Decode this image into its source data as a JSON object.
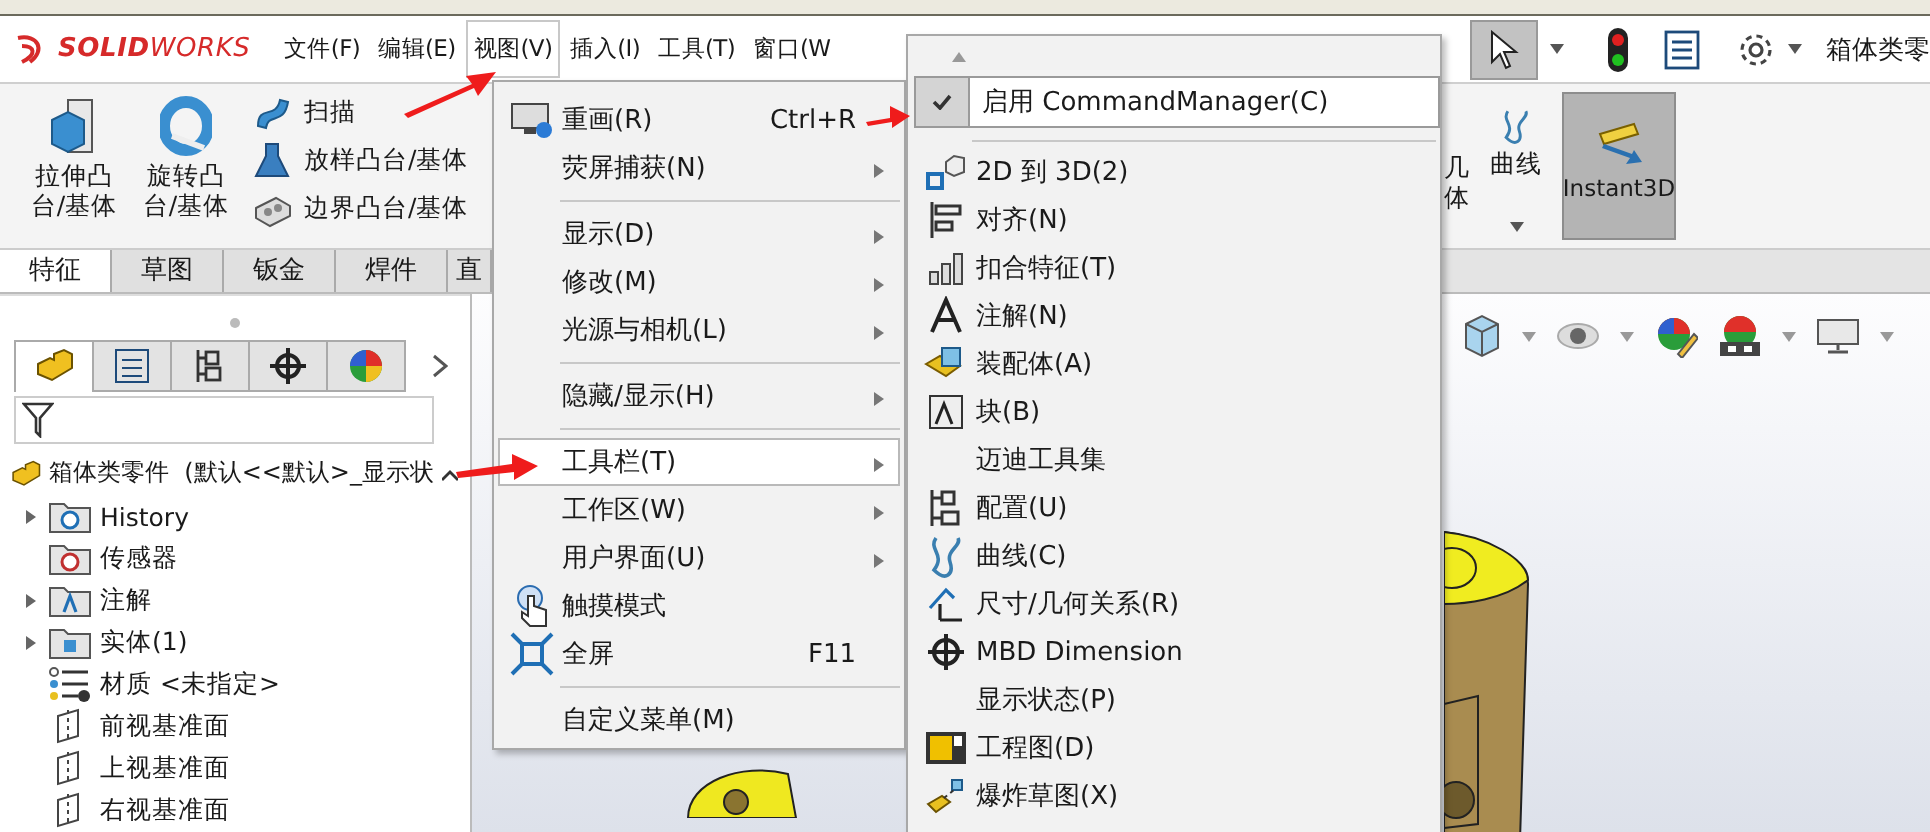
{
  "logo": "**SOLID**WORKS",
  "menu_bar": [
    {
      "label": "文件(F)",
      "selected": false
    },
    {
      "label": "编辑(E)",
      "selected": false
    },
    {
      "label": "视图(V)",
      "selected": true
    },
    {
      "label": "插入(I)",
      "selected": false
    },
    {
      "label": "工具(T)",
      "selected": false
    },
    {
      "label": "窗口(W",
      "selected": false
    }
  ],
  "document_title": "箱体类零",
  "ribbon": {
    "large_buttons": [
      {
        "label": "拉伸凸台/基体",
        "kind": "extrude"
      },
      {
        "label": "旋转凸台/基体",
        "kind": "revolve"
      }
    ],
    "small_buttons": [
      {
        "label": "扫描",
        "kind": "sweep"
      },
      {
        "label": "放样凸台/基体",
        "kind": "loft"
      },
      {
        "label": "边界凸台/基体",
        "kind": "boundary"
      }
    ],
    "right_buttons": [
      {
        "kind": "cut",
        "label": "几体",
        "on": false
      },
      {
        "kind": "curves",
        "label": "曲线",
        "on": false
      },
      {
        "kind": "instant3d",
        "label": "Instant3D",
        "on": true
      }
    ]
  },
  "command_tabs": [
    {
      "label": "特征",
      "selected": true
    },
    {
      "label": "草图",
      "selected": false
    },
    {
      "label": "钣金",
      "selected": false
    },
    {
      "label": "焊件",
      "selected": false
    },
    {
      "label": "直",
      "selected": false
    }
  ],
  "feature_tree": {
    "panel_tabs": [
      {
        "kind": "features",
        "selected": true
      },
      {
        "kind": "properties",
        "selected": false
      },
      {
        "kind": "configurations",
        "selected": false
      },
      {
        "kind": "dimxpert",
        "selected": false
      },
      {
        "kind": "display",
        "selected": false
      }
    ],
    "root": "箱体类零件  (默认<<默认>_显示状",
    "items": [
      {
        "label": "History",
        "kind": "history",
        "expandable": true
      },
      {
        "label": "传感器",
        "kind": "sensor",
        "expandable": false
      },
      {
        "label": "注解",
        "kind": "annotation",
        "expandable": true
      },
      {
        "label": "实体(1)",
        "kind": "solid",
        "expandable": true
      },
      {
        "label": "材质 <未指定>",
        "kind": "material",
        "expandable": false
      },
      {
        "label": "前视基准面",
        "kind": "plane",
        "expandable": false
      },
      {
        "label": "上视基准面",
        "kind": "plane",
        "expandable": false
      },
      {
        "label": "右视基准面",
        "kind": "plane",
        "expandable": false
      }
    ]
  },
  "view_menu": {
    "groups": [
      [
        {
          "label": "重画(R)",
          "kind": "redraw",
          "shortcut": "Ctrl+R",
          "submenu": false,
          "selected": false
        },
        {
          "label": "荧屏捕获(N)",
          "submenu": true,
          "selected": false
        }
      ],
      [
        {
          "label": "显示(D)",
          "submenu": true,
          "selected": false
        },
        {
          "label": "修改(M)",
          "submenu": true,
          "selected": false
        },
        {
          "label": "光源与相机(L)",
          "submenu": true,
          "selected": false
        }
      ],
      [
        {
          "label": "隐藏/显示(H)",
          "submenu": true,
          "selected": false
        }
      ],
      [
        {
          "label": "工具栏(T)",
          "submenu": true,
          "selected": true
        },
        {
          "label": "工作区(W)",
          "submenu": true,
          "selected": false
        },
        {
          "label": "用户界面(U)",
          "submenu": true,
          "selected": false
        },
        {
          "label": "触摸模式",
          "kind": "touch",
          "submenu": false,
          "selected": false
        },
        {
          "label": "全屏",
          "kind": "fullscreen",
          "shortcut": "F11",
          "submenu": false,
          "selected": false
        }
      ],
      [
        {
          "label": "自定义菜单(M)",
          "submenu": false,
          "selected": false
        }
      ]
    ]
  },
  "toolbars_menu": {
    "command_manager": {
      "label": "启用 CommandManager(C)",
      "checked": true,
      "selected": true
    },
    "items": [
      {
        "label": "2D 到 3D(2)",
        "kind": "convert",
        "selected": false
      },
      {
        "label": "对齐(N)",
        "kind": "align",
        "selected": false
      },
      {
        "label": "扣合特征(T)",
        "kind": "fastening",
        "selected": false
      },
      {
        "label": "注解(N)",
        "kind": "annotation",
        "selected": false
      },
      {
        "label": "装配体(A)",
        "kind": "assembly",
        "selected": false
      },
      {
        "label": "块(B)",
        "kind": "block",
        "selected": false
      },
      {
        "label": "迈迪工具集",
        "selected": false
      },
      {
        "label": "配置(U)",
        "kind": "config",
        "selected": false
      },
      {
        "label": "曲线(C)",
        "kind": "curves",
        "selected": false
      },
      {
        "label": "尺寸/几何关系(R)",
        "kind": "dimension",
        "selected": false
      },
      {
        "label": "MBD Dimension",
        "kind": "mbd",
        "selected": false
      },
      {
        "label": "显示状态(P)",
        "selected": false
      },
      {
        "label": "工程图(D)",
        "kind": "drawing",
        "selected": false
      },
      {
        "label": "爆炸草图(X)",
        "kind": "explode",
        "selected": false
      }
    ]
  }
}
